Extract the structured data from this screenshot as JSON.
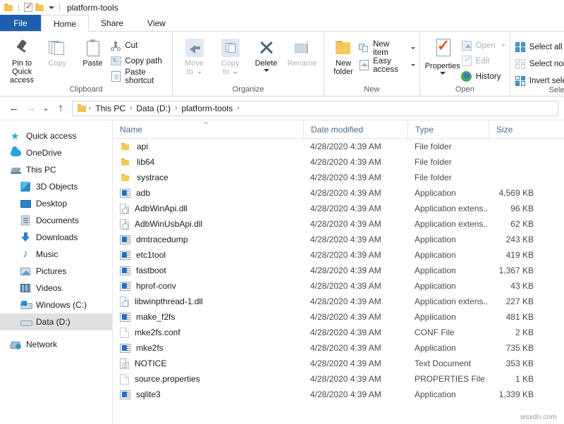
{
  "titlebar": {
    "title": "platform-tools",
    "qat": [
      {
        "name": "folder-icon",
        "label": "platform-tools"
      },
      {
        "name": "properties-icon",
        "label": "Properties"
      },
      {
        "name": "new-folder-icon",
        "label": "New folder"
      },
      {
        "name": "customize-caret-icon",
        "label": "Customize Quick Access Toolbar"
      }
    ]
  },
  "tabs": [
    {
      "id": "file",
      "label": "File"
    },
    {
      "id": "home",
      "label": "Home"
    },
    {
      "id": "share",
      "label": "Share"
    },
    {
      "id": "view",
      "label": "View"
    }
  ],
  "ribbon": {
    "clipboard": {
      "title": "Clipboard",
      "pin": "Pin to Quick\naccess",
      "pin_line1": "Pin to Quick",
      "pin_line2": "access",
      "copy": "Copy",
      "paste": "Paste",
      "cut": "Cut",
      "copy_path": "Copy path",
      "paste_shortcut": "Paste shortcut"
    },
    "organize": {
      "title": "Organize",
      "move_to_line1": "Move",
      "move_to_line2": "to",
      "copy_to_line1": "Copy",
      "copy_to_line2": "to",
      "delete": "Delete",
      "rename": "Rename"
    },
    "new": {
      "title": "New",
      "new_folder_line1": "New",
      "new_folder_line2": "folder",
      "new_item": "New item",
      "easy_access": "Easy access"
    },
    "open": {
      "title": "Open",
      "properties": "Properties",
      "open": "Open",
      "edit": "Edit",
      "history": "History"
    },
    "select": {
      "title": "Select",
      "select_all": "Select all",
      "select_none": "Select none",
      "invert_selection": "Invert selection"
    }
  },
  "addressbar": {
    "back": "←",
    "forward": "→",
    "recent": "⌄",
    "up": "↑",
    "breadcrumbs": [
      "This PC",
      "Data (D:)",
      "platform-tools"
    ],
    "separator": "›"
  },
  "sidebar": {
    "items": [
      {
        "label": "Quick access",
        "icon": "star-icon",
        "indent": false,
        "selected": false
      },
      {
        "label": "OneDrive",
        "icon": "cloud-icon",
        "indent": false,
        "selected": false
      },
      {
        "label": "This PC",
        "icon": "this-pc-icon",
        "indent": false,
        "selected": false
      },
      {
        "label": "3D Objects",
        "icon": "3d-objects-icon",
        "indent": true,
        "selected": false
      },
      {
        "label": "Desktop",
        "icon": "desktop-icon",
        "indent": true,
        "selected": false
      },
      {
        "label": "Documents",
        "icon": "documents-icon",
        "indent": true,
        "selected": false
      },
      {
        "label": "Downloads",
        "icon": "downloads-icon",
        "indent": true,
        "selected": false
      },
      {
        "label": "Music",
        "icon": "music-icon",
        "indent": true,
        "selected": false
      },
      {
        "label": "Pictures",
        "icon": "pictures-icon",
        "indent": true,
        "selected": false
      },
      {
        "label": "Videos",
        "icon": "videos-icon",
        "indent": true,
        "selected": false
      },
      {
        "label": "Windows (C:)",
        "icon": "drive-c-icon",
        "indent": true,
        "selected": false
      },
      {
        "label": "Data (D:)",
        "icon": "drive-d-icon",
        "indent": true,
        "selected": true
      },
      {
        "label": "Network",
        "icon": "network-icon",
        "indent": false,
        "selected": false
      }
    ]
  },
  "filelist": {
    "columns": [
      {
        "label": "Name",
        "sorted": "asc",
        "sort_glyph": "^"
      },
      {
        "label": "Date modified",
        "sorted": "none"
      },
      {
        "label": "Type",
        "sorted": "none"
      },
      {
        "label": "Size",
        "sorted": "none"
      }
    ],
    "rows": [
      {
        "name": "api",
        "date": "4/28/2020 4:39 AM",
        "type": "File folder",
        "size": "",
        "icon": "folder-icon"
      },
      {
        "name": "lib64",
        "date": "4/28/2020 4:39 AM",
        "type": "File folder",
        "size": "",
        "icon": "folder-icon"
      },
      {
        "name": "systrace",
        "date": "4/28/2020 4:39 AM",
        "type": "File folder",
        "size": "",
        "icon": "folder-icon"
      },
      {
        "name": "adb",
        "date": "4/28/2020 4:39 AM",
        "type": "Application",
        "size": "4,569 KB",
        "icon": "application-icon"
      },
      {
        "name": "AdbWinApi.dll",
        "date": "4/28/2020 4:39 AM",
        "type": "Application extens...",
        "size": "96 KB",
        "icon": "dll-icon"
      },
      {
        "name": "AdbWinUsbApi.dll",
        "date": "4/28/2020 4:39 AM",
        "type": "Application extens...",
        "size": "62 KB",
        "icon": "dll-icon"
      },
      {
        "name": "dmtracedump",
        "date": "4/28/2020 4:39 AM",
        "type": "Application",
        "size": "243 KB",
        "icon": "application-icon"
      },
      {
        "name": "etc1tool",
        "date": "4/28/2020 4:39 AM",
        "type": "Application",
        "size": "419 KB",
        "icon": "application-icon"
      },
      {
        "name": "fastboot",
        "date": "4/28/2020 4:39 AM",
        "type": "Application",
        "size": "1,367 KB",
        "icon": "application-icon"
      },
      {
        "name": "hprof-conv",
        "date": "4/28/2020 4:39 AM",
        "type": "Application",
        "size": "43 KB",
        "icon": "application-icon"
      },
      {
        "name": "libwinpthread-1.dll",
        "date": "4/28/2020 4:39 AM",
        "type": "Application extens...",
        "size": "227 KB",
        "icon": "dll-icon"
      },
      {
        "name": "make_f2fs",
        "date": "4/28/2020 4:39 AM",
        "type": "Application",
        "size": "481 KB",
        "icon": "application-icon"
      },
      {
        "name": "mke2fs.conf",
        "date": "4/28/2020 4:39 AM",
        "type": "CONF File",
        "size": "2 KB",
        "icon": "blank-file-icon"
      },
      {
        "name": "mke2fs",
        "date": "4/28/2020 4:39 AM",
        "type": "Application",
        "size": "735 KB",
        "icon": "application-icon"
      },
      {
        "name": "NOTICE",
        "date": "4/28/2020 4:39 AM",
        "type": "Text Document",
        "size": "353 KB",
        "icon": "text-document-icon"
      },
      {
        "name": "source.properties",
        "date": "4/28/2020 4:39 AM",
        "type": "PROPERTIES File",
        "size": "1 KB",
        "icon": "blank-file-icon"
      },
      {
        "name": "sqlite3",
        "date": "4/28/2020 4:39 AM",
        "type": "Application",
        "size": "1,339 KB",
        "icon": "application-icon"
      }
    ]
  },
  "watermark": "wsxdn.com",
  "colors": {
    "file_tab": "#1c5fae",
    "header_text": "#4a6b8a",
    "selection": "#e0e0e0",
    "folder": "#f5c95b"
  }
}
